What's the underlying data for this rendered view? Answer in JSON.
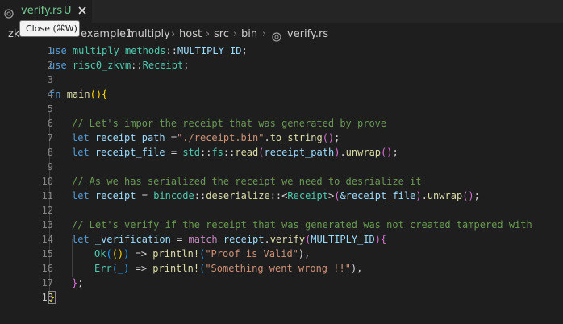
{
  "tab": {
    "filename": "verify.rs",
    "status": "U",
    "close_label": "✕"
  },
  "tooltip": {
    "text": "Close (⌘W)"
  },
  "breadcrumb": [
    "zk",
    "host",
    "example1",
    "multiply",
    "host",
    "src",
    "bin",
    "verify.rs"
  ],
  "breadcrumb_sep": "›",
  "gutter": [
    "1",
    "2",
    "3",
    "4",
    "5",
    "6",
    "7",
    "8",
    "9",
    "10",
    "11",
    "12",
    "13",
    "14",
    "15",
    "16",
    "17",
    "18"
  ],
  "code": {
    "l1": [
      "use",
      " ",
      "multiply_methods",
      "::",
      "MULTIPLY_ID",
      ";"
    ],
    "l2": [
      "use",
      " ",
      "risc0_zkvm",
      "::",
      "Receipt",
      ";"
    ],
    "l4": [
      "fn",
      " ",
      "main",
      "()",
      "{"
    ],
    "l6": "// Let's impor the receipt that was generated by prove",
    "l7": [
      "let",
      " ",
      "receipt_path",
      " =",
      "\"./receipt.bin\"",
      ".",
      "to_string",
      "()",
      ";"
    ],
    "l8": [
      "let",
      " ",
      "receipt_file",
      " = ",
      "std",
      "::",
      "fs",
      "::",
      "read",
      "(",
      "receipt_path",
      ")",
      ".",
      "unwrap",
      "()",
      ";"
    ],
    "l10": "// As we has serialized the receipt we need to desrialize it",
    "l11": [
      "let",
      " ",
      "receipt",
      " = ",
      "bincode",
      "::",
      "deserialize",
      "::<",
      "Receipt",
      ">",
      "(",
      "&receipt_file",
      ")",
      ".",
      "unwrap",
      "()",
      ";"
    ],
    "l13": "// Let's verify if the receipt that was generated was not created tampered with",
    "l14": [
      "let",
      " ",
      "_verification",
      " = ",
      "match",
      " ",
      "receipt",
      ".",
      "verify",
      "(",
      "MULTIPLY_ID",
      ")",
      "{"
    ],
    "l15": [
      "Ok",
      "(",
      "()",
      ")",
      " => ",
      "println!",
      "(",
      "\"Proof is Valid\"",
      "),"
    ],
    "l16": [
      "Err",
      "(_)",
      " => ",
      "println!",
      "(",
      "\"Something went wrong !!\"",
      "),"
    ],
    "l17": [
      "}",
      ";"
    ],
    "l18": [
      "}"
    ]
  }
}
